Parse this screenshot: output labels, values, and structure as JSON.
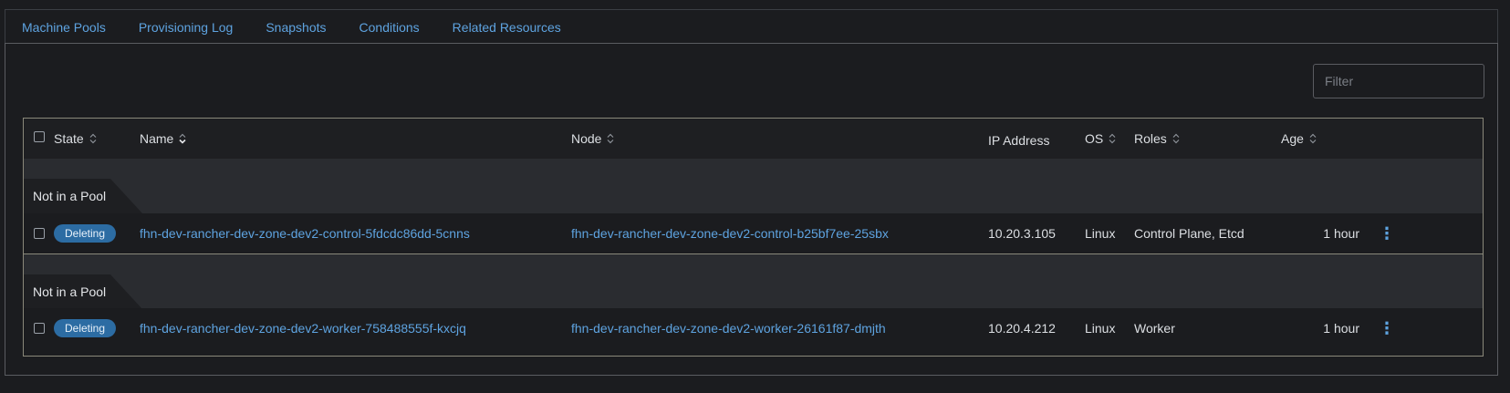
{
  "tabs": [
    {
      "label": "Machine Pools",
      "active": true
    },
    {
      "label": "Provisioning Log"
    },
    {
      "label": "Snapshots"
    },
    {
      "label": "Conditions"
    },
    {
      "label": "Related Resources"
    }
  ],
  "filter": {
    "placeholder": "Filter",
    "value": ""
  },
  "columns": {
    "state": "State",
    "name": "Name",
    "node": "Node",
    "ip": "IP Address",
    "os": "OS",
    "roles": "Roles",
    "age": "Age"
  },
  "groups": [
    {
      "label": "Not in a Pool",
      "rows": [
        {
          "state": "Deleting",
          "name": "fhn-dev-rancher-dev-zone-dev2-control-5fdcdc86dd-5cnns",
          "node": "fhn-dev-rancher-dev-zone-dev2-control-b25bf7ee-25sbx",
          "ip": "10.20.3.105",
          "os": "Linux",
          "roles": "Control Plane, Etcd",
          "age": "1 hour"
        }
      ]
    },
    {
      "label": "Not in a Pool",
      "rows": [
        {
          "state": "Deleting",
          "name": "fhn-dev-rancher-dev-zone-dev2-worker-758488555f-kxcjq",
          "node": "fhn-dev-rancher-dev-zone-dev2-worker-26161f87-dmjth",
          "ip": "10.20.4.212",
          "os": "Linux",
          "roles": "Worker",
          "age": "1 hour"
        }
      ]
    }
  ],
  "colors": {
    "accent": "#5ea3e0",
    "badge": "#2c6ca3",
    "background": "#1b1c1f"
  },
  "icons": {
    "sort": "sort-updown-icon",
    "sort_active": "sort-down-icon",
    "row_actions": "kebab-vertical-icon"
  }
}
